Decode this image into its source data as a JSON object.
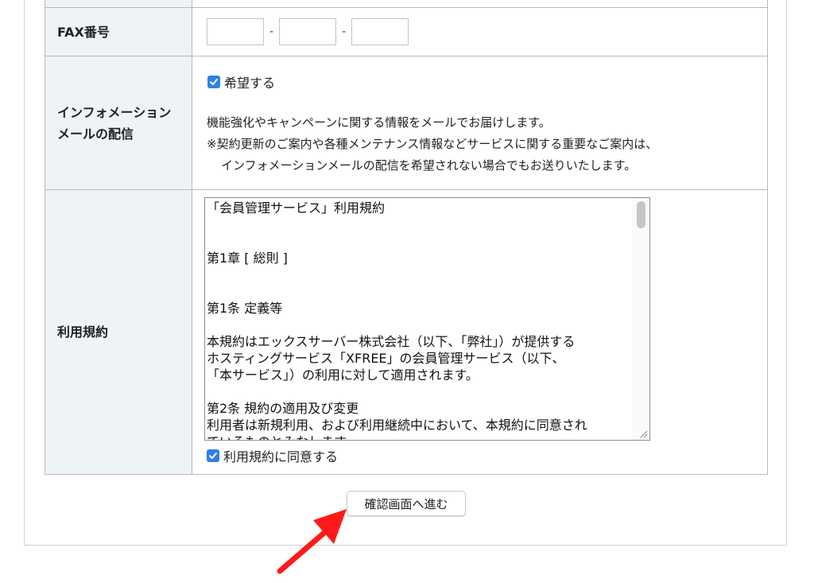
{
  "fax": {
    "label": "FAX番号",
    "separator": "-",
    "inputs": [
      "",
      "",
      ""
    ]
  },
  "info_mail": {
    "label_line1": "インフォメーション",
    "label_line2": "メールの配信",
    "checkbox_label": "希望する",
    "checked": true,
    "text_line1": "機能強化やキャンペーンに関する情報をメールでお届けします。",
    "text_line2": "※契約更新のご案内や各種メンテナンス情報などサービスに関する重要なご案内は、",
    "text_line3": "インフォメーションメールの配信を希望されない場合でもお送りいたします。"
  },
  "terms": {
    "label": "利用規約",
    "lines": [
      "「会員管理サービス」利用規約",
      "",
      "",
      "第1章 [ 総則 ]",
      "",
      "",
      "第1条 定義等",
      "",
      "本規約はエックスサーバー株式会社（以下、「弊社」）が提供する",
      "ホスティングサービス「XFREE」の会員管理サービス（以下、",
      "「本サービス」）の利用に対して適用されます。",
      "",
      "第2条 規約の適用及び変更",
      "利用者は新規利用、および利用継続中において、本規約に同意され",
      "ているものとみなします。"
    ],
    "agree_label": "利用規約に同意する",
    "agree_checked": true
  },
  "submit": {
    "label": "確認画面へ進む"
  },
  "colors": {
    "header_bg": "#eef3f6",
    "checkbox": "#2f80e4",
    "arrow": "#ff1a1a"
  }
}
